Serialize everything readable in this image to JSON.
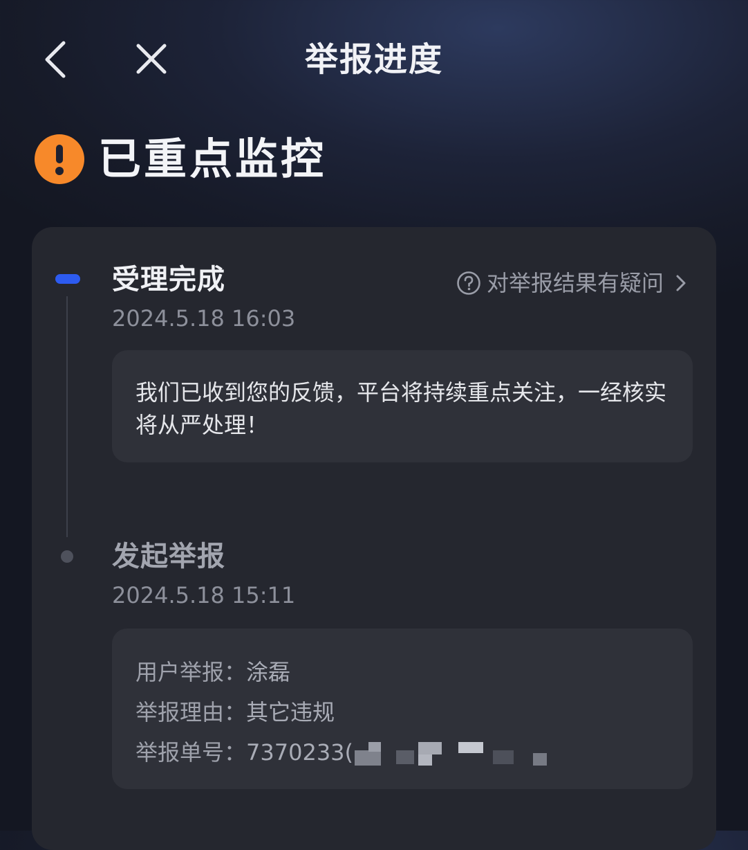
{
  "nav": {
    "title": "举报进度"
  },
  "status": {
    "title": "已重点监控",
    "color": "#f7892a"
  },
  "timeline": {
    "step1": {
      "title": "受理完成",
      "time": "2024.5.18 16:03",
      "link_label": "对举报结果有疑问",
      "message": "我们已收到您的反馈，平台将持续重点关注，一经核实将从严处理！"
    },
    "step2": {
      "title": "发起举报",
      "time": "2024.5.18 15:11",
      "rows": [
        {
          "label": "用户举报：",
          "value": "涂磊"
        },
        {
          "label": "举报理由：",
          "value": "其它违规"
        },
        {
          "label": "举报单号：",
          "value": "7370233("
        }
      ]
    }
  },
  "colors": {
    "accent_blue": "#2d5bf0",
    "warning_orange": "#f7892a"
  },
  "icons": {
    "back": "chevron-left-icon",
    "close": "close-icon",
    "warning": "exclamation-icon",
    "help": "question-circle-icon",
    "arrow": "chevron-right-icon"
  }
}
